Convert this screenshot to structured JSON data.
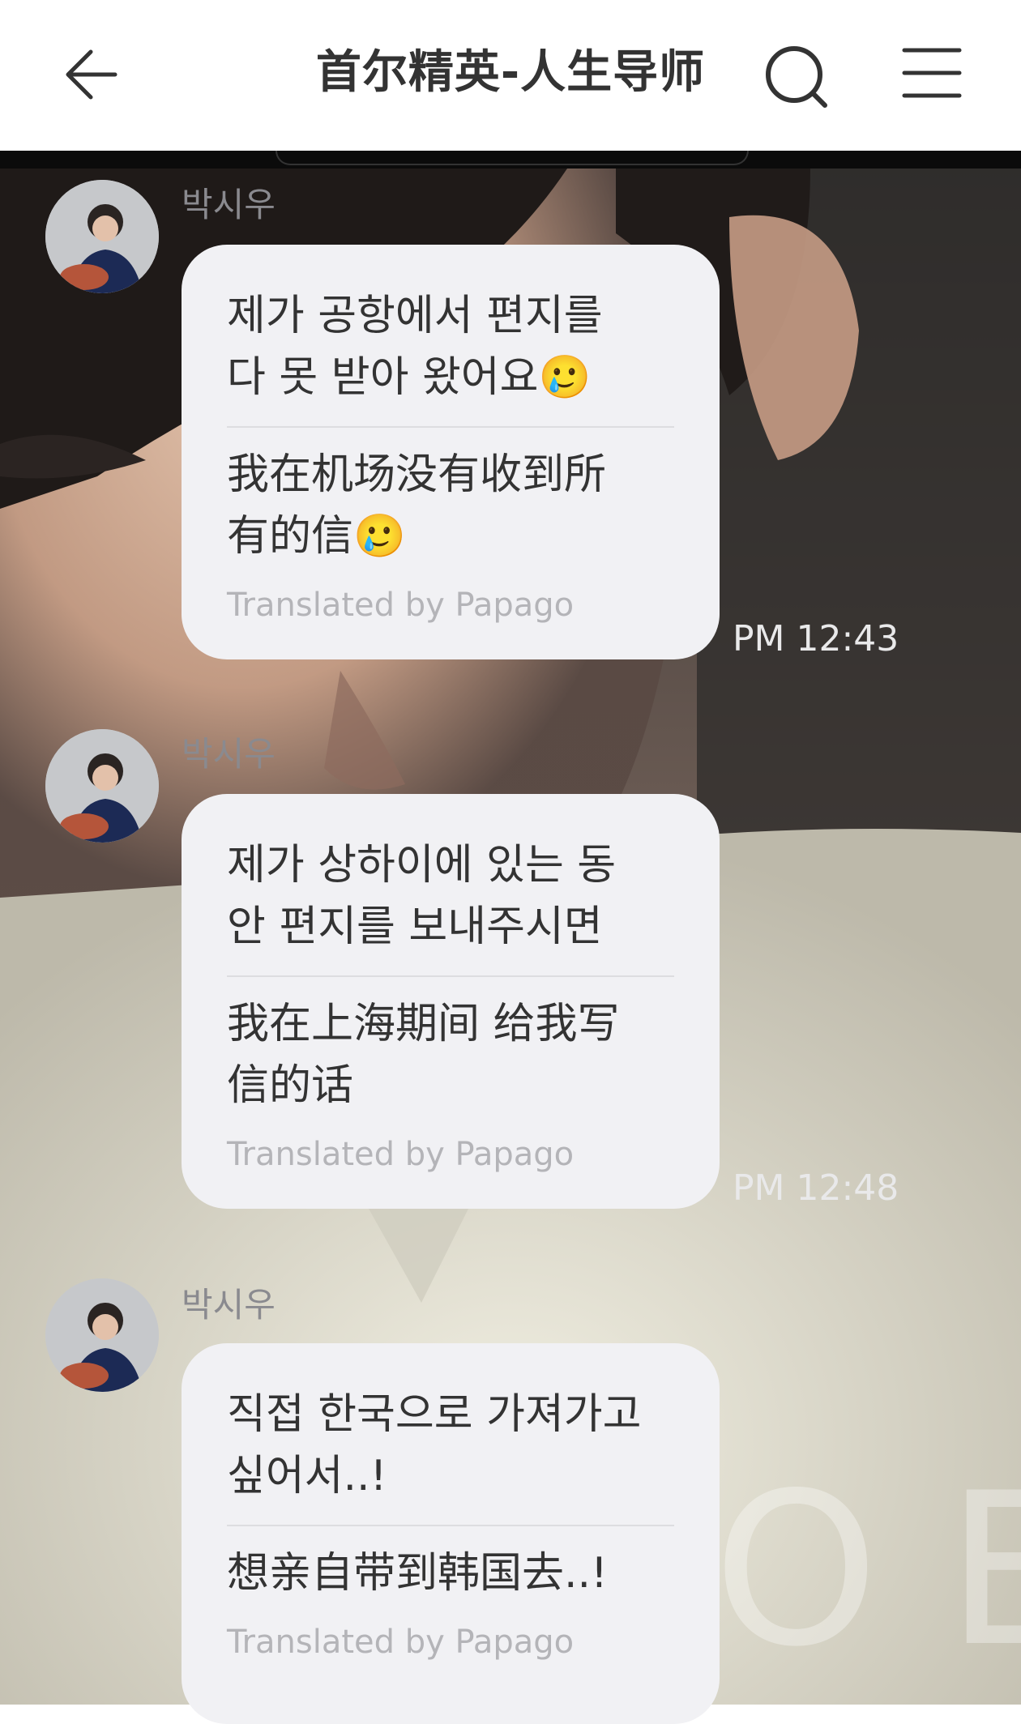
{
  "header": {
    "title": "首尔精英-人生导师",
    "back_icon": "back-arrow-icon",
    "search_icon": "search-icon",
    "menu_icon": "menu-icon"
  },
  "messages": [
    {
      "sender": "박시우",
      "original": "제가 공항에서 편지를\n다 못 받아 왔어요🥲",
      "translation": "我在机场没有收到所\n有的信🥲",
      "footer": "Translated by Papago",
      "time": "PM 12:43"
    },
    {
      "sender": "박시우",
      "original": "제가 상하이에 있는 동\n안 편지를 보내주시면",
      "translation": "我在上海期间 给我写\n信的话",
      "footer": "Translated by Papago",
      "time": "PM 12:48"
    },
    {
      "sender": "박시우",
      "original": "직접 한국으로 가져가고\n싶어서..!",
      "translation": "想亲自带到韩国去..!",
      "footer": "Translated by Papago"
    }
  ],
  "colors": {
    "bubble": "#f1f1f4",
    "text": "#333333",
    "sender": "#8a8a8f",
    "footer": "#b4b4b8"
  }
}
